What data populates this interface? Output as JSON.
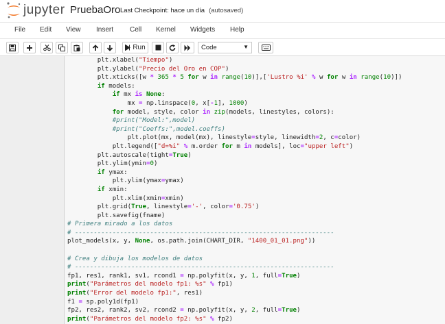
{
  "header": {
    "logo_text": "jupyter",
    "notebook_name": "PruebaOro",
    "checkpoint": "Last Checkpoint: hace un día",
    "autosave": "(autosaved)"
  },
  "menu": [
    "File",
    "Edit",
    "View",
    "Insert",
    "Cell",
    "Kernel",
    "Widgets",
    "Help"
  ],
  "toolbar": {
    "run_label": "Run",
    "cell_type": "Code",
    "icons": [
      "save-icon",
      "plus-icon",
      "cut-icon",
      "copy-icon",
      "paste-icon",
      "arrow-up-icon",
      "arrow-down-icon",
      "run-icon",
      "stop-icon",
      "restart-icon",
      "restart-run-icon",
      "keyboard-icon"
    ]
  },
  "code": {
    "lines": [
      "        plt.xlabel(\"Tiempo\")",
      "        plt.ylabel(\"Precio del Oro en COP\")",
      "        plt.xticks([w * 365 * 5 for w in range(10)],['Lustro %i' % w for w in range(10)])",
      "        if models:",
      "            if mx is None:",
      "                mx = np.linspace(0, x[-1], 1000)",
      "            for model, style, color in zip(models, linestyles, colors):",
      "            #print(\"Model:\",model)",
      "            #print(\"Coeffs:\",model.coeffs)",
      "                plt.plot(mx, model(mx), linestyle=style, linewidth=2, c=color)",
      "            plt.legend([\"d=%i\" % m.order for m in models], loc=\"upper left\")",
      "        plt.autoscale(tight=True)",
      "        plt.ylim(ymin=0)",
      "        if ymax:",
      "            plt.ylim(ymax=ymax)",
      "        if xmin:",
      "            plt.xlim(xmin=xmin)",
      "        plt.grid(True, linestyle='-', color='0.75')",
      "        plt.savefig(fname)",
      "# Primera mirado a los datos",
      "# ---------------------------------------------------------------------",
      "plot_models(x, y, None, os.path.join(CHART_DIR, \"1400_01_01.png\"))",
      "",
      "# Crea y dibuja los modelos de datos",
      "# ---------------------------------------------------------------------",
      "fp1, res1, rank1, sv1, rcond1 = np.polyfit(x, y, 1, full=True)",
      "print(\"Parámetros del modelo fp1: %s\" % fp1)",
      "print(\"Error del modelo fp1:\", res1)",
      "f1 = sp.poly1d(fp1)",
      "fp2, res2, rank2, sv2, rcond2 = np.polyfit(x, y, 2, full=True)",
      "print(\"Parámetros del modelo fp2: %s\" % fp2)"
    ]
  }
}
